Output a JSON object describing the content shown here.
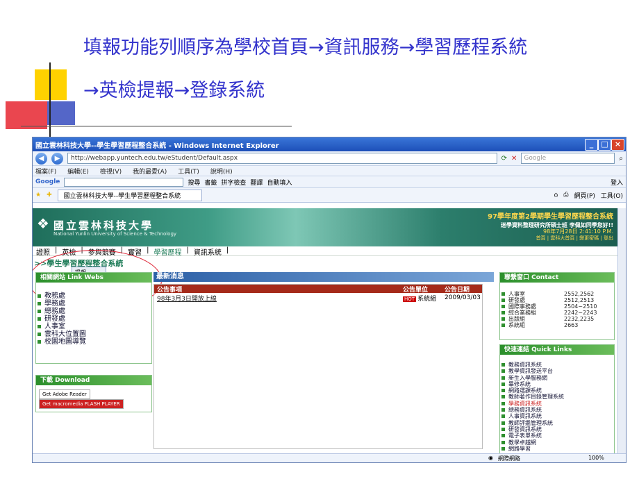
{
  "slide": {
    "line1": "填報功能列順序為學校首頁→資訊服務→學習歷程系統",
    "line2": "→英檢提報→登錄系統"
  },
  "browser": {
    "title": "國立雲林科技大學--學生學習歷程整合系統 - Windows Internet Explorer",
    "address": "http://webapp.yuntech.edu.tw/eStudent/Default.aspx",
    "search_placeholder": "Google",
    "menu": [
      "檔案(F)",
      "編輯(E)",
      "檢視(V)",
      "我的最愛(A)",
      "工具(T)",
      "說明(H)"
    ],
    "google_toolbar": "Google",
    "toolbar_items": [
      "搜尋",
      "書籤",
      "拼字檢查",
      "翻譯",
      "自動填入"
    ],
    "login_label": "登入",
    "tab_label": "國立雲林科技大學--學生學習歷程整合系統",
    "cmd_items": [
      "網頁(P)",
      "工具(O)"
    ],
    "status_zone": "網際網路",
    "zoom": "100%"
  },
  "site": {
    "school_name": "國立雲林科技大學",
    "school_en": "National Yunlin University of Science & Technology",
    "header_title": "97學年度第2學期學生學習歷程整合系統",
    "welcome": "迷學資料整理研究所碩士班  李佩如同學您好!!",
    "datetime": "98年7月28日 2:41:10 P.M.",
    "header_links": "首頁 | 雲科大首頁 | 變更密碼 | 登出",
    "nav": [
      "證照",
      "英檢",
      "參與競賽",
      "實習",
      "學習歷程",
      "資訊系統"
    ],
    "breadcrumb": ">>學生學習歷程整合系統",
    "submenu": [
      "提報",
      "查詢"
    ],
    "links_header": "相關網站 Link Webs",
    "links": [
      "教務處",
      "學務處",
      "總務處",
      "研發處",
      "人事室",
      "雲科大位置圖",
      "校園地圖導覽"
    ],
    "download_header": "下載 Download",
    "download_items": [
      "Get Adobe Reader",
      "Get macromedia FLASH PLAYER"
    ],
    "news_header": "最新消息",
    "news_cols": [
      "公告事項",
      "公告單位",
      "公告日期"
    ],
    "news_rows": [
      {
        "title": "98年3月3日開放上線",
        "hot": "HOT",
        "unit": "系統組",
        "date": "2009/03/03"
      }
    ],
    "contact_header": "聯繫窗口 Contact",
    "contacts": [
      {
        "name": "人事室",
        "ext": "2552,2562"
      },
      {
        "name": "研發處",
        "ext": "2512,2513"
      },
      {
        "name": "國際事務處",
        "ext": "2504~2510"
      },
      {
        "name": "綜合業務組",
        "ext": "2242~2243"
      },
      {
        "name": "出版組",
        "ext": "2232,2235"
      },
      {
        "name": "系統組",
        "ext": "2663"
      }
    ],
    "quick_header": "快速連結 Quick Links",
    "quick_links": [
      "教務資訊系統",
      "教學資訊發送平台",
      "新生入學服務網",
      "畢修系統",
      "網路選課系統",
      "教師著作目錄管理系統",
      "學務資訊系統",
      "總務資訊系統",
      "人事資訊系統",
      "教師評鑑管理系統",
      "研發資訊系統",
      "電子表單系統",
      "教學卓越網",
      "網路學習"
    ]
  }
}
